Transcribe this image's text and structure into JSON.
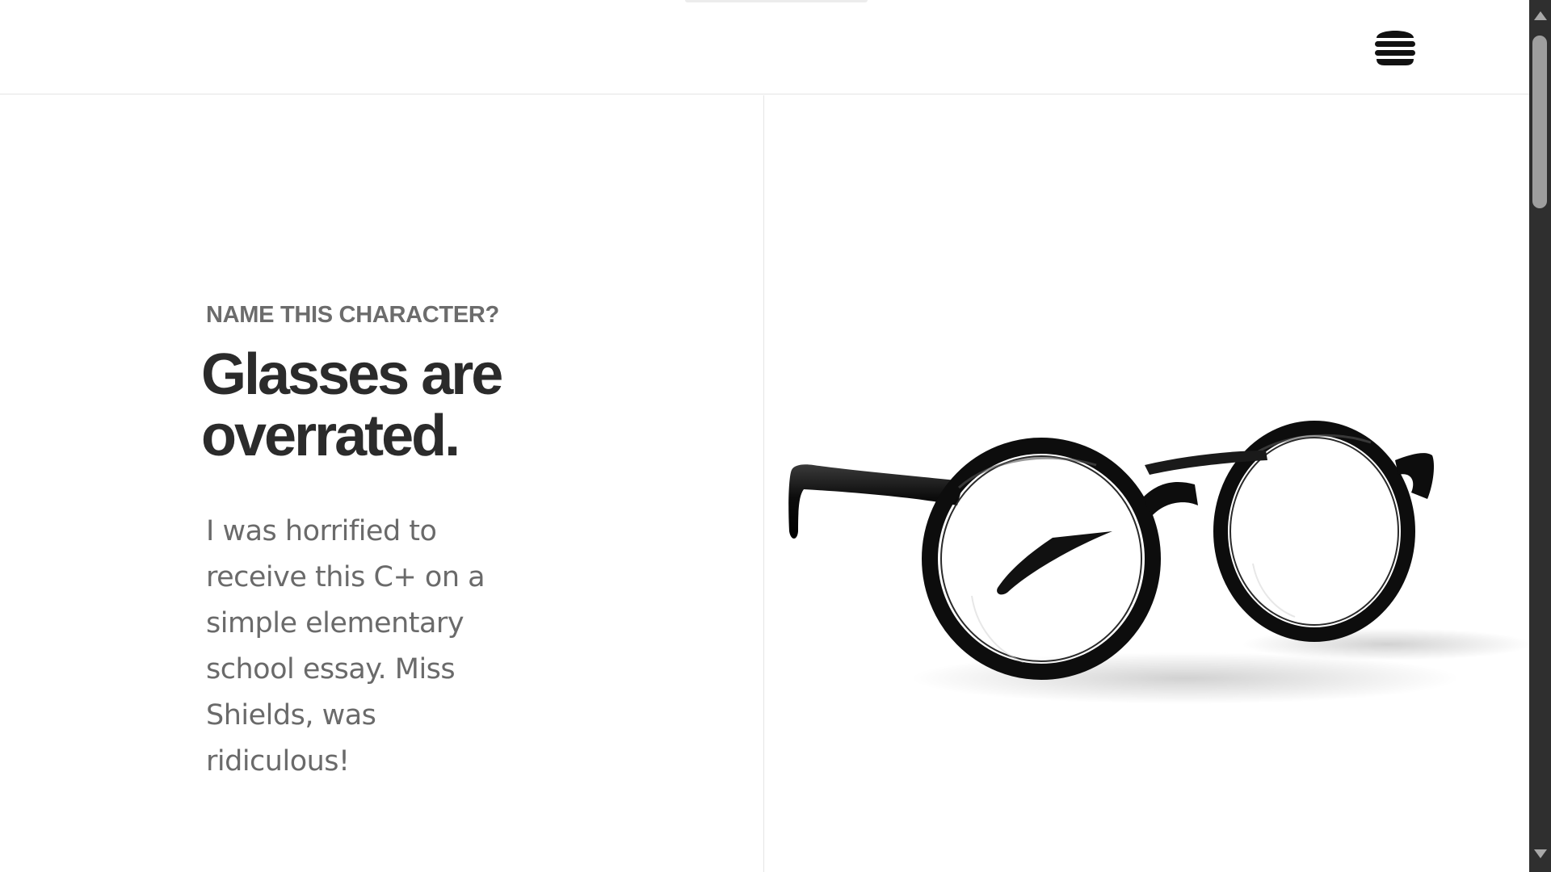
{
  "header": {
    "menu_icon": "hamburger-menu-icon"
  },
  "hero": {
    "eyebrow": "NAME THIS CHARACTER?",
    "headline": "Glasses are overrated.",
    "body": "I was horrified to receive this C+ on a simple elementary school essay. Miss Shields, was ridiculous!"
  },
  "image": {
    "subject": "glasses"
  },
  "colors": {
    "headline": "#2b2b2b",
    "eyebrow": "#6c6c6c",
    "body": "#6a6a6a",
    "divider": "#e4e4e4",
    "scrollbar_track": "#2f2f2f",
    "scrollbar_thumb": "#9e9e9e"
  }
}
